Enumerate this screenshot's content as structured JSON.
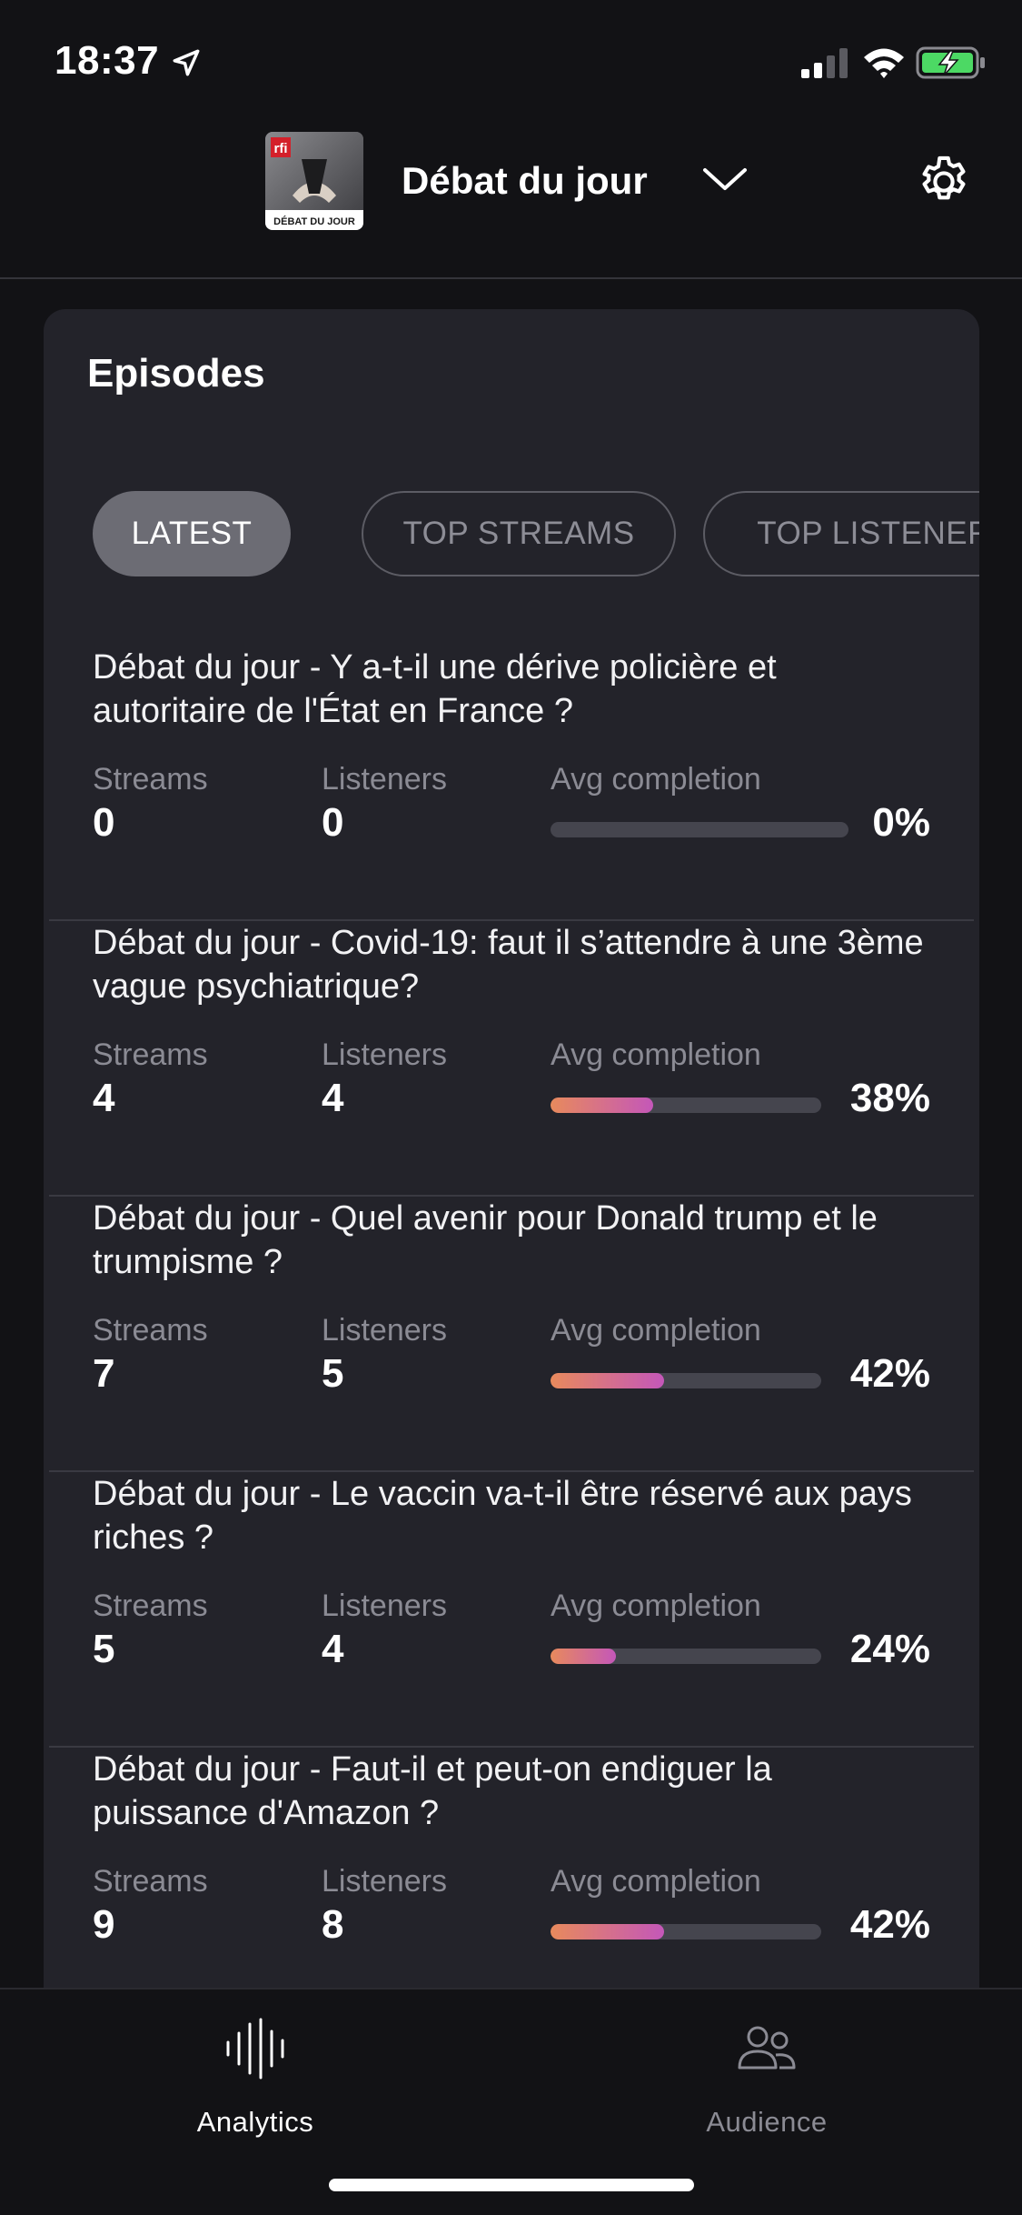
{
  "status_bar": {
    "time": "18:37",
    "icons": [
      "location-arrow-icon",
      "signal-icon",
      "wifi-icon",
      "battery-charging-icon"
    ],
    "battery_color": "#4cd964"
  },
  "header": {
    "cover_brand": "rfi",
    "cover_caption": "DÉBAT DU JOUR",
    "podcast_name": "Débat du jour",
    "icons": [
      "chevron-down-icon",
      "gear-icon"
    ]
  },
  "card": {
    "title": "Episodes",
    "tabs": [
      {
        "label": "LATEST",
        "active": true
      },
      {
        "label": "TOP STREAMS",
        "active": false
      },
      {
        "label": "TOP LISTENERS",
        "active": false
      }
    ],
    "stat_labels": {
      "streams": "Streams",
      "listeners": "Listeners",
      "completion": "Avg completion"
    },
    "episodes": [
      {
        "title": "Débat du jour - Y a-t-il une dérive policière et autoritaire de l'État en France ?",
        "streams": "0",
        "listeners": "0",
        "completion": 0,
        "completion_label": "0%"
      },
      {
        "title": "Débat du jour - Covid-19: faut il s’attendre à une 3ème vague psychiatrique?",
        "streams": "4",
        "listeners": "4",
        "completion": 38,
        "completion_label": "38%"
      },
      {
        "title": "Débat du jour - Quel avenir pour Donald trump et le trumpisme ?",
        "streams": "7",
        "listeners": "5",
        "completion": 42,
        "completion_label": "42%"
      },
      {
        "title": "Débat du jour - Le vaccin va-t-il être réservé aux pays riches ?",
        "streams": "5",
        "listeners": "4",
        "completion": 24,
        "completion_label": "24%"
      },
      {
        "title": "Débat du jour - Faut-il et peut-on endiguer la puissance d'Amazon ?",
        "streams": "9",
        "listeners": "8",
        "completion": 42,
        "completion_label": "42%"
      }
    ]
  },
  "bottom_nav": {
    "items": [
      {
        "label": "Analytics",
        "icon": "waveform-icon",
        "active": true
      },
      {
        "label": "Audience",
        "icon": "people-icon",
        "active": false
      }
    ]
  },
  "colors": {
    "background": "#121215",
    "card": "#23232a",
    "accent_gradient_start": "#e88a5c",
    "accent_gradient_end": "#c457b9"
  }
}
